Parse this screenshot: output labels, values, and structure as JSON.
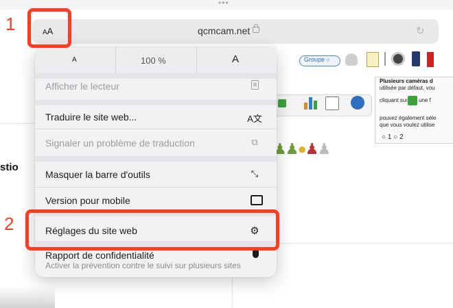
{
  "browser": {
    "aa_label_small": "A",
    "aa_label_large": "A",
    "url": "qcmcam.net",
    "more_dots": "•••",
    "reload_icon": "reload-icon"
  },
  "site": {
    "fragment_text": "stio",
    "group_pill": "Groupe ○",
    "camera_box": {
      "title": "Plusieurs caméras d",
      "lines": [
        "utilisée par défaut, vou",
        "cliquant sur",
        "pouvez également séle",
        "que vous voulez utilise"
      ],
      "after_icon_text": "une f",
      "radios": "○ 1 ○ 2"
    }
  },
  "menu": {
    "zoom": {
      "decrease_label": "A",
      "level": "100 %",
      "increase_label": "A"
    },
    "items": [
      {
        "label": "Afficher le lecteur",
        "icon": "reader-icon",
        "enabled": false
      },
      {
        "label": "Traduire le site web...",
        "icon": "translate-icon",
        "icon_glyph": "A文",
        "enabled": true
      },
      {
        "label": "Signaler un problème de traduction",
        "icon": "report-icon",
        "icon_glyph": "⧉",
        "enabled": false
      },
      {
        "label": "Masquer la barre d'outils",
        "icon": "collapse-arrows-icon",
        "icon_glyph": "⤡",
        "enabled": true
      },
      {
        "label": "Version pour mobile",
        "icon": "mobile-icon",
        "enabled": true
      },
      {
        "label": "Réglages du site web",
        "icon": "settings-icon",
        "icon_glyph": "⚙",
        "enabled": true
      },
      {
        "label": "Rapport de confidentialité",
        "icon": "shield-icon",
        "enabled": true
      }
    ],
    "privacy_subtitle": "Activer la prévention contre le suivi sur plusieurs sites"
  },
  "annotations": [
    {
      "number": "1",
      "target": "aa-button"
    },
    {
      "number": "2",
      "target": "website-settings"
    }
  ],
  "colors": {
    "annotation": "#ff3b1f",
    "menu_bg": "#f2f2f4",
    "url_bar": "#e9e9ec"
  }
}
